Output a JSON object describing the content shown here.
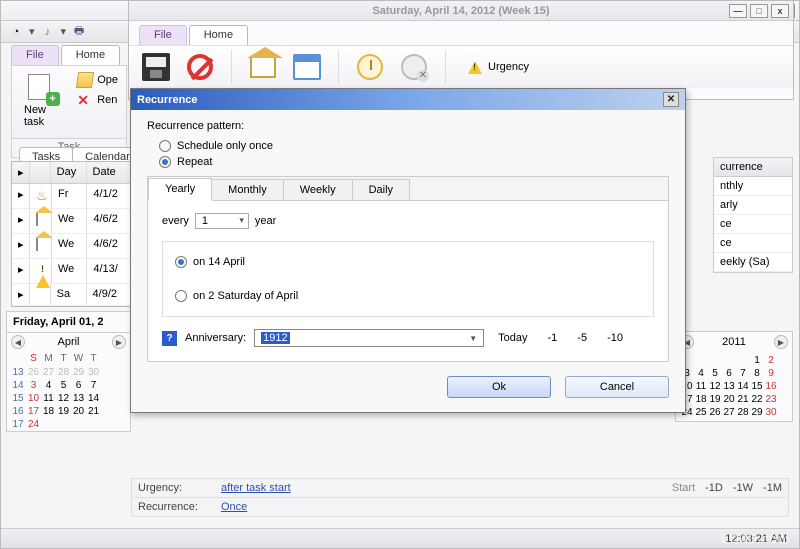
{
  "win2": {
    "date_title": "Saturday, April 14, 2012 (Week 15)",
    "file_tab": "File",
    "home_tab": "Home",
    "urgency_btn": "Urgency"
  },
  "main": {
    "file_tab": "File",
    "home_tab": "Home",
    "new_task": "New task",
    "open": "Ope",
    "remove": "Ren",
    "task_group": "Task",
    "sub_tasks": "Tasks",
    "sub_calendar": "Calendar"
  },
  "grid": {
    "h_day": "Day",
    "h_date": "Date",
    "rows": [
      {
        "day": "Fr",
        "date": "4/1/2"
      },
      {
        "day": "We",
        "date": "4/6/2"
      },
      {
        "day": "We",
        "date": "4/6/2"
      },
      {
        "day": "We",
        "date": "4/13/"
      },
      {
        "day": "Sa",
        "date": "4/9/2"
      }
    ]
  },
  "cal_left": {
    "title": "Friday, April 01, 2",
    "month": "April",
    "dow": [
      "",
      "S",
      "M",
      "T",
      "W",
      "T"
    ],
    "weeks": [
      [
        "13",
        "26",
        "27",
        "28",
        "29",
        "30"
      ],
      [
        "14",
        "3",
        "4",
        "5",
        "6",
        "7"
      ],
      [
        "15",
        "10",
        "11",
        "12",
        "13",
        "14"
      ],
      [
        "16",
        "17",
        "18",
        "19",
        "20",
        "21"
      ],
      [
        "17",
        "24",
        "",
        "",
        "",
        ""
      ]
    ]
  },
  "right_col": {
    "header": "currence",
    "items": [
      "nthly",
      "arly",
      "ce",
      "ce",
      "eekly (Sa)"
    ]
  },
  "cal_right": {
    "year": "2011",
    "rows": [
      [
        "",
        "",
        "",
        "",
        "",
        "1",
        "2"
      ],
      [
        "3",
        "4",
        "5",
        "6",
        "7",
        "8",
        "9"
      ],
      [
        "10",
        "11",
        "12",
        "13",
        "14",
        "15",
        "16"
      ],
      [
        "17",
        "18",
        "19",
        "20",
        "21",
        "22",
        "23"
      ],
      [
        "24",
        "25",
        "26",
        "27",
        "28",
        "29",
        "30"
      ]
    ]
  },
  "detail": {
    "urgency_k": "Urgency:",
    "urgency_v": "after task start",
    "start": "Start",
    "d1": "-1D",
    "d2": "-1W",
    "d3": "-1M",
    "rec_k": "Recurrence:",
    "rec_v": "Once"
  },
  "dlg": {
    "title": "Recurrence",
    "pattern_label": "Recurrence pattern:",
    "opt_once": "Schedule only once",
    "opt_repeat": "Repeat",
    "tab_yearly": "Yearly",
    "tab_monthly": "Monthly",
    "tab_weekly": "Weekly",
    "tab_daily": "Daily",
    "every": "every",
    "every_val": "1",
    "year_word": "year",
    "on_date": "on 14 April",
    "on_ord": "on 2 Saturday of April",
    "anniv_label": "Anniversary:",
    "anniv_val": "1912",
    "today": "Today",
    "m1": "-1",
    "m5": "-5",
    "m10": "-10",
    "ok": "Ok",
    "cancel": "Cancel"
  },
  "status": {
    "time": "12:03:21 AM"
  },
  "watermark": "LO4D.com"
}
